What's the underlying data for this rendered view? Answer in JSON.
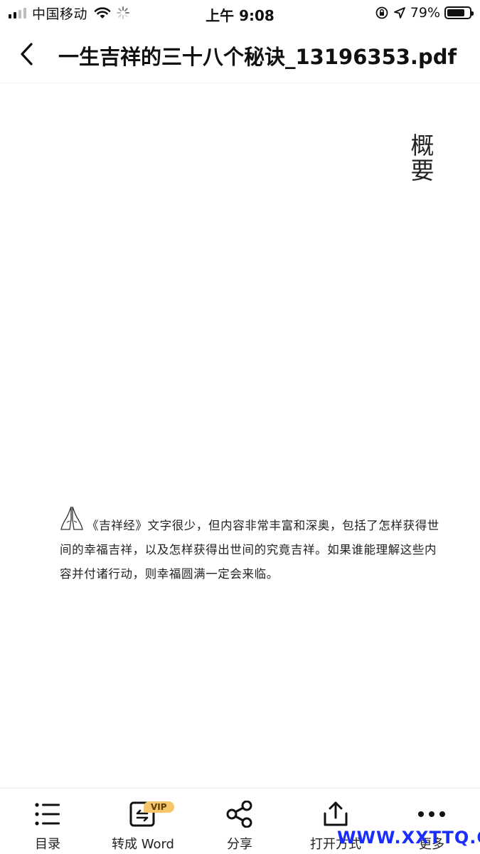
{
  "status_bar": {
    "carrier": "中国移动",
    "time": "上午 9:08",
    "battery_percent": "79%",
    "battery_level": 0.79
  },
  "nav": {
    "title": "一生吉祥的三十八个秘诀_13196353.pdf",
    "back_icon": "chevron-left-icon"
  },
  "document": {
    "heading_vertical": [
      "概",
      "要"
    ],
    "paragraph": "《吉祥经》文字很少，但内容非常丰富和深奥，包括了怎样获得世间的幸福吉祥，以及怎样获得出世间的究竟吉祥。如果谁能理解这些内容并付诸行动，则幸福圆满一定会来临。"
  },
  "toolbar": {
    "items": [
      {
        "label": "目录",
        "icon": "list-icon"
      },
      {
        "label": "转成 Word",
        "icon": "convert-icon",
        "badge": "VIP"
      },
      {
        "label": "分享",
        "icon": "share-icon"
      },
      {
        "label": "打开方式",
        "icon": "upload-icon"
      },
      {
        "label": "更多",
        "icon": "more-icon"
      }
    ]
  },
  "watermark": "WWW.XXTTQ.COM"
}
